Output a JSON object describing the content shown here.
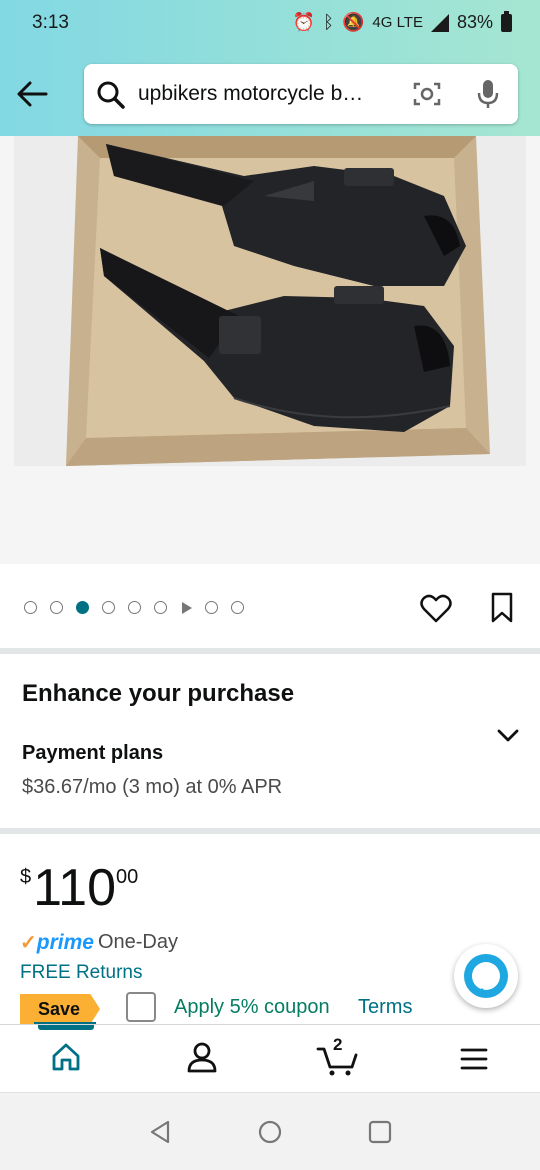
{
  "status_bar": {
    "time": "3:13",
    "network": "4G LTE",
    "battery": "83%"
  },
  "search": {
    "query": "upbikers motorcycle b…"
  },
  "gallery": {
    "image_description_icon": "product-photo",
    "current_index": 3,
    "total": 9
  },
  "enhance": {
    "title": "Enhance your purchase",
    "payment_title": "Payment plans",
    "payment_detail": "$36.67/mo (3 mo) at 0% APR"
  },
  "price": {
    "symbol": "$",
    "whole": "110",
    "fraction": "00"
  },
  "delivery": {
    "prime_check": "✓",
    "prime_word": "prime",
    "speed": "One-Day",
    "returns": "FREE Returns"
  },
  "coupon": {
    "badge": "Save",
    "label": "Apply 5% coupon",
    "terms": "Terms"
  },
  "nav": {
    "cart_count": "2"
  },
  "colors": {
    "accent": "#007185",
    "prime_blue": "#1a98ff",
    "coupon_green": "#067d62",
    "save_badge": "#fbb034",
    "header_gradient_start": "#82d8e3",
    "header_gradient_end": "#a5e6d1"
  }
}
